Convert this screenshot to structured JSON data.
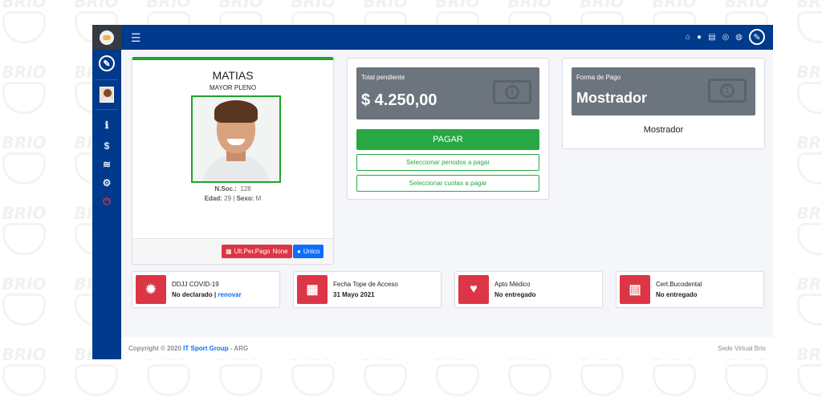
{
  "watermark": {
    "text": "BRIO"
  },
  "sidebar": {
    "items": [
      {
        "icon": "info-icon",
        "glyph": "ℹ"
      },
      {
        "icon": "dollar-icon",
        "glyph": "$"
      },
      {
        "icon": "layers-icon",
        "glyph": "≋"
      },
      {
        "icon": "cogs-icon",
        "glyph": "⚙"
      },
      {
        "icon": "power-icon",
        "glyph": "⏻"
      }
    ],
    "accent_color": "#dc3545"
  },
  "topbar": {
    "menu_glyph": "☰",
    "icons": [
      "home-icon",
      "user-icon",
      "file-icon",
      "whatsapp-icon",
      "chat-icon"
    ]
  },
  "profile": {
    "name": "MATIAS",
    "category": "MAYOR PLENO",
    "nsoc_label": "N.Soc.:",
    "nsoc_value": "128",
    "edad_label": "Edad:",
    "edad_value": "29",
    "sexo_label": "Sexo:",
    "sexo_value": "M",
    "btn_ult_label": "Ult.Per.Pago",
    "btn_ult_value": "None",
    "btn_unico_label": "Unico"
  },
  "payment": {
    "total_label": "Total pendiente",
    "total_value": "$ 4.250,00",
    "pagar_button": "PAGAR",
    "select_periods": "Seleccionar periodos a pagar",
    "select_cuotas": "Seleccionar cuotas a pagar"
  },
  "forma_pago": {
    "label": "Forma de Pago",
    "value": "Mostrador",
    "name": "Mostrador"
  },
  "stats": [
    {
      "title": "DDJJ COVID-19",
      "value": "No declarado",
      "sep": " | ",
      "link": "renovar"
    },
    {
      "title": "Fecha Tope de Acceso",
      "value": "31 Mayo 2021"
    },
    {
      "title": "Apto Médico",
      "value": "No entregado"
    },
    {
      "title": "Cert.Bucodental",
      "value": "No entregado"
    }
  ],
  "footer": {
    "copy_prefix": "Copyright © 2020",
    "company": "IT Sport Group",
    "copy_suffix": "- ARG",
    "right": "Sede Virtual Brio"
  }
}
